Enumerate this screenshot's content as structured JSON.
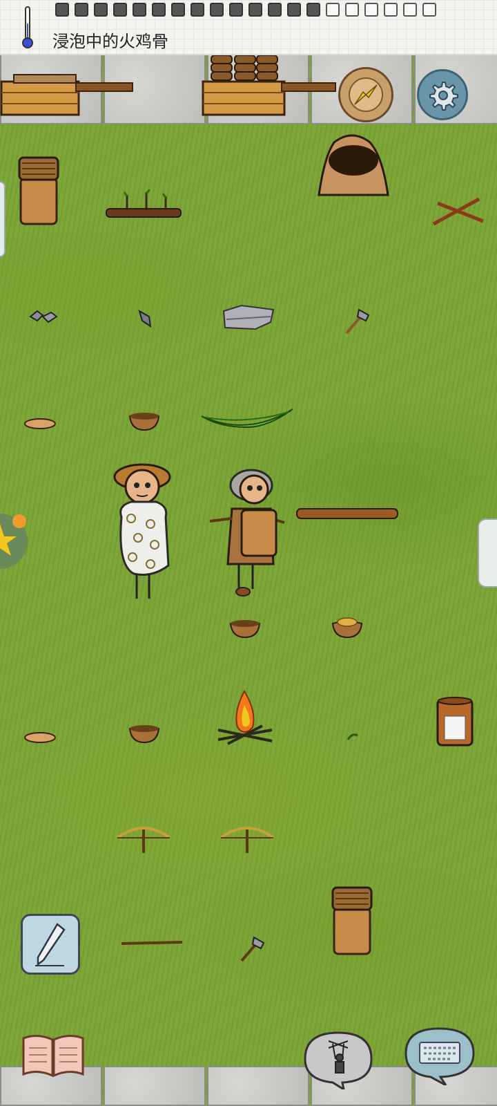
{
  "status_bar": {
    "status_text": "浸泡中的火鸡骨",
    "thermometer_icon": "thermometer-icon",
    "hunger_pips": [
      {
        "filled": true
      },
      {
        "filled": true
      },
      {
        "filled": true
      },
      {
        "filled": true
      },
      {
        "filled": true
      },
      {
        "filled": true
      },
      {
        "filled": true
      },
      {
        "filled": true
      },
      {
        "filled": true
      },
      {
        "filled": true
      },
      {
        "filled": true
      },
      {
        "filled": true
      },
      {
        "filled": true
      },
      {
        "filled": true
      },
      {
        "filled": false
      },
      {
        "filled": false
      },
      {
        "filled": false
      },
      {
        "filled": false
      },
      {
        "filled": false
      },
      {
        "filled": false
      }
    ]
  },
  "hud": {
    "compass_icon": "compass-icon",
    "settings_icon": "gear-icon",
    "note_icon": "pencil-icon",
    "recipe_book_icon": "book-icon",
    "emote_icon": "puppet-emote-icon",
    "keyboard_icon": "keyboard-icon"
  },
  "world_objects": [
    "wooden-crate-icon",
    "wooden-crate-icon",
    "woven-basket-on-pot-icon",
    "sapling-row-icon",
    "adobe-kiln-icon",
    "crossed-sticks-icon",
    "flint-chips-icon",
    "sharp-stone-icon",
    "flat-rock-icon",
    "stone-hatchet-icon",
    "flatbread-icon",
    "clay-bowl-icon",
    "leaf-icon",
    "flatbread-icon",
    "clay-bowl-icon",
    "campfire-icon",
    "clay-bowl-icon",
    "bowl-of-food-icon",
    "crock-of-salt-icon",
    "bow-drill-icon",
    "bow-drill-icon",
    "long-shaft-icon",
    "stone-hatchet-icon",
    "woven-basket-on-pot-icon",
    "butt-log-icon"
  ],
  "colors": {
    "grass": "#7da537",
    "stone": "#c9c9c6",
    "fire": "#f07a1a",
    "compass_face": "#c9a06a",
    "settings_face": "#6a95a8"
  }
}
